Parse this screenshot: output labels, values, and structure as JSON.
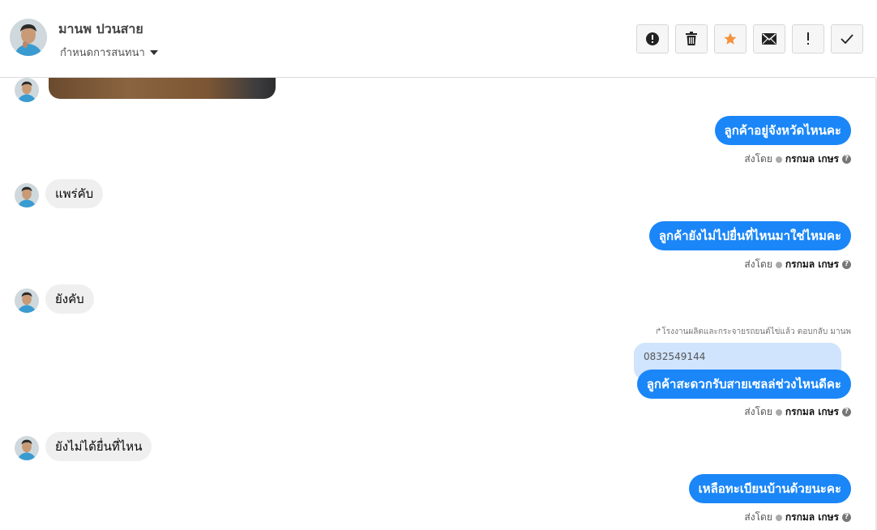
{
  "header": {
    "contact_name": "มานพ ปวนสาย",
    "conversation_setting": "กำหนดการสนทนา",
    "actions": [
      {
        "name": "report-button",
        "icon": "alert-circle-icon"
      },
      {
        "name": "delete-button",
        "icon": "trash-icon"
      },
      {
        "name": "star-button",
        "icon": "star-icon"
      },
      {
        "name": "mail-button",
        "icon": "envelope-icon"
      },
      {
        "name": "important-button",
        "icon": "exclamation-icon"
      },
      {
        "name": "done-button",
        "icon": "check-icon"
      }
    ]
  },
  "colors": {
    "outgoing": "#1a86f8",
    "incoming": "#efefef",
    "quote": "#d0e4fd",
    "star": "#f5923e"
  },
  "sent_by_label": "ส่งโดย",
  "agent_name": "กรกมล เกษร",
  "messages": [
    {
      "dir": "in",
      "type": "image"
    },
    {
      "dir": "out",
      "text": "ลูกค้าอยู่จังหวัดไหนคะ"
    },
    {
      "dir": "in",
      "text": "แพร่คับ"
    },
    {
      "dir": "out",
      "text": "ลูกค้ายังไม่ไปยื่นที่ไหนมาใช่ไหมคะ"
    },
    {
      "dir": "in",
      "text": "ยังคับ"
    },
    {
      "dir": "out",
      "text": "ลูกค้าสะดวกรับสายเซลล่ช่วงไหนดีคะ",
      "reply_note": "โรงงานผลิตและกระจายรถยนต์ไข่แล้ว ตอบกลับ มานพ",
      "quoted_text": "0832549144"
    },
    {
      "dir": "in",
      "text": "ยังไม่ได้ยื่นที่ไหน"
    },
    {
      "dir": "out",
      "text": "เหลือทะเบียนบ้านด้วยนะคะ"
    }
  ]
}
